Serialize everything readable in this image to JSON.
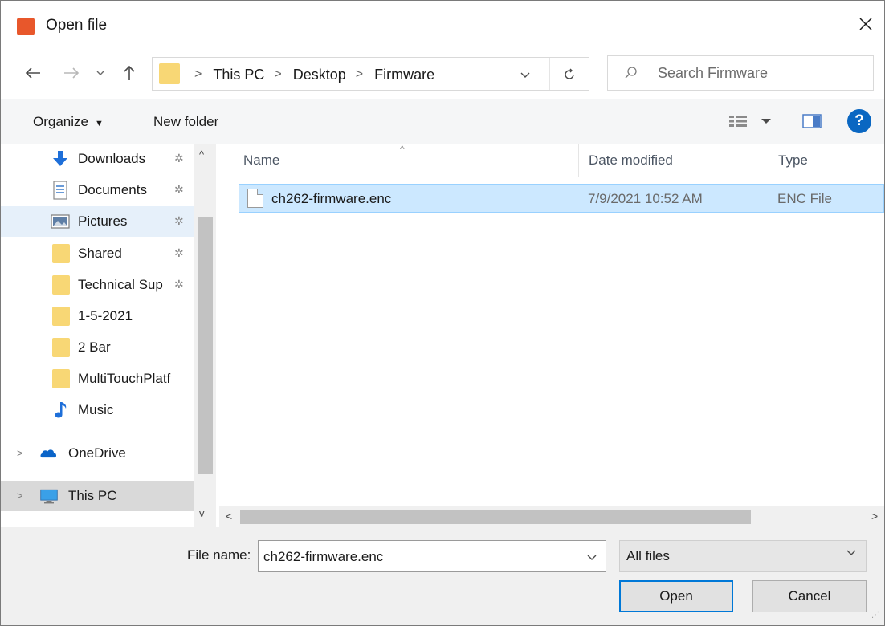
{
  "window": {
    "title": "Open file",
    "accent": "#e8572b"
  },
  "address": {
    "crumbs": [
      "This PC",
      "Desktop",
      "Firmware"
    ],
    "separator": ">"
  },
  "search": {
    "placeholder": "Search Firmware"
  },
  "toolbar": {
    "organize_label": "Organize",
    "new_folder_label": "New folder",
    "help_label": "?"
  },
  "sidebar": {
    "items": [
      {
        "label": "Downloads",
        "icon": "download-arrow-icon",
        "pinned": true
      },
      {
        "label": "Documents",
        "icon": "document-icon",
        "pinned": true
      },
      {
        "label": "Pictures",
        "icon": "pictures-icon",
        "pinned": true,
        "selected": true
      },
      {
        "label": "Shared",
        "icon": "folder-icon",
        "pinned": true
      },
      {
        "label": "Technical Sup",
        "icon": "folder-icon",
        "pinned": true
      },
      {
        "label": "1-5-2021",
        "icon": "folder-icon",
        "pinned": false
      },
      {
        "label": "2 Bar",
        "icon": "folder-icon",
        "pinned": false
      },
      {
        "label": "MultiTouchPlatf",
        "icon": "folder-icon",
        "pinned": false
      },
      {
        "label": "Music",
        "icon": "music-note-icon",
        "pinned": false
      },
      {
        "label": "OneDrive",
        "icon": "cloud-icon",
        "pinned": false
      },
      {
        "label": "This PC",
        "icon": "computer-icon",
        "pinned": false
      }
    ]
  },
  "file_list": {
    "columns": [
      "Name",
      "Date modified",
      "Type"
    ],
    "rows": [
      {
        "name": "ch262-firmware.enc",
        "date": "7/9/2021 10:52 AM",
        "type": "ENC File"
      }
    ]
  },
  "footer": {
    "file_name_label": "File name:",
    "file_name_value": "ch262-firmware.enc",
    "file_type_value": "All files",
    "open_label": "Open",
    "cancel_label": "Cancel"
  }
}
